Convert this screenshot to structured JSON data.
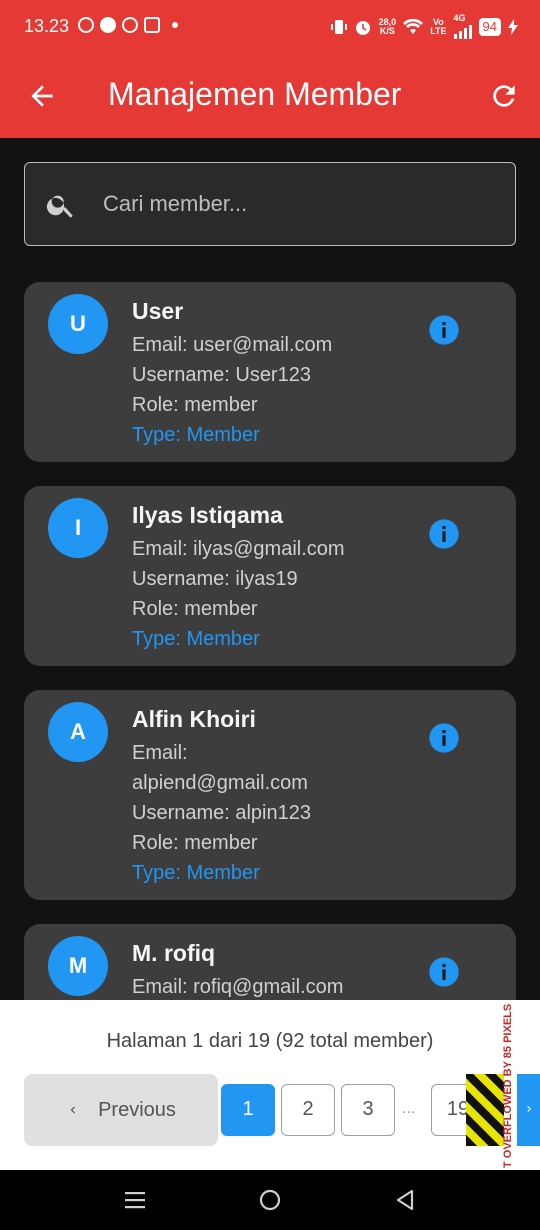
{
  "status_bar": {
    "time": "13.23",
    "net_speed_value": "28,0",
    "net_speed_unit": "K/S",
    "volte_top": "Vo",
    "volte_bottom": "LTE",
    "network": "4G",
    "battery": "94"
  },
  "app_bar": {
    "title": "Manajemen Member"
  },
  "search": {
    "placeholder": "Cari member..."
  },
  "members": [
    {
      "initial": "U",
      "name": "User",
      "email": "Email: user@mail.com",
      "username": "Username: User123",
      "role": "Role: member",
      "type": "Type: Member"
    },
    {
      "initial": "I",
      "name": "Ilyas Istiqama",
      "email": "Email: ilyas@gmail.com",
      "username": "Username: ilyas19",
      "role": "Role: member",
      "type": "Type: Member"
    },
    {
      "initial": "A",
      "name": "Alfin Khoiri",
      "email_label": "Email:",
      "email_value": "alpiend@gmail.com",
      "username": "Username: alpin123",
      "role": "Role: member",
      "type": "Type: Member"
    },
    {
      "initial": "M",
      "name": "M. rofiq",
      "email": "Email: rofiq@gmail.com"
    }
  ],
  "pagination": {
    "info": "Halaman 1 dari 19 (92 total member)",
    "previous_label": "Previous",
    "pages": [
      "1",
      "2",
      "3",
      "19"
    ],
    "ellipsis": "...",
    "overflow_warning": "T OVERFLOWED BY 85 PIXELS"
  },
  "colors": {
    "app_bar": "#e53935",
    "accent": "#2196f3",
    "card": "#3d3d3d",
    "background": "#121212"
  }
}
